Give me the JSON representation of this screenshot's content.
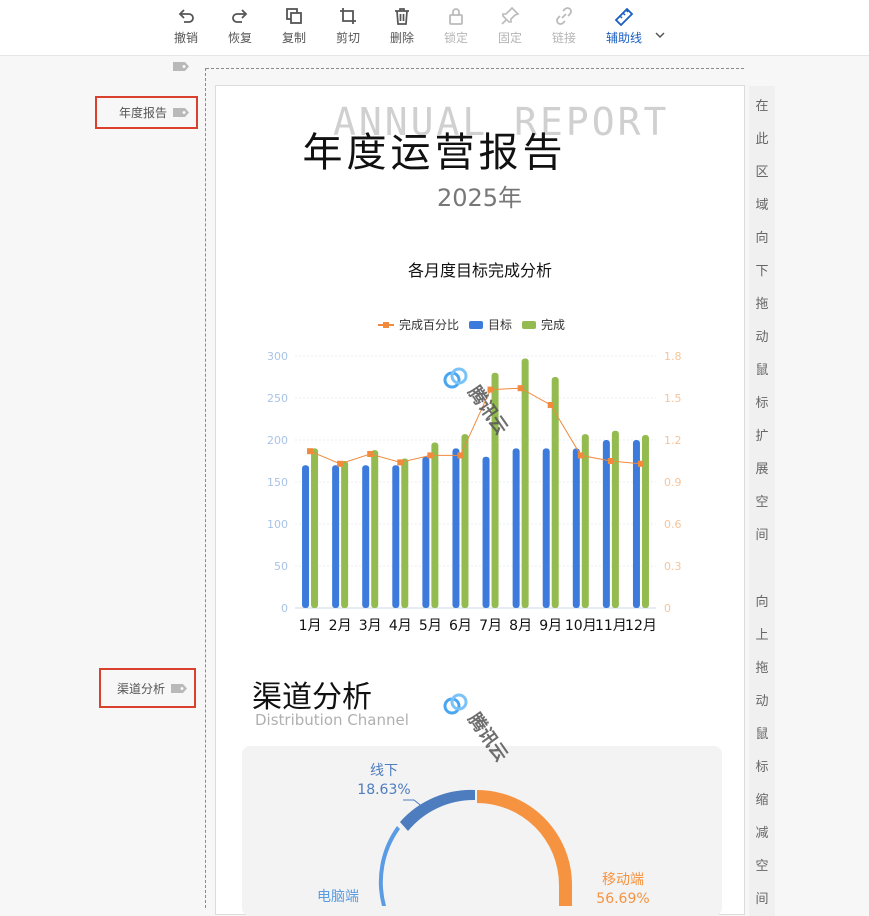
{
  "toolbar": {
    "items": [
      {
        "label": "撤销",
        "icon": "undo-icon",
        "state": "normal"
      },
      {
        "label": "恢复",
        "icon": "redo-icon",
        "state": "normal"
      },
      {
        "label": "复制",
        "icon": "copy-icon",
        "state": "normal"
      },
      {
        "label": "剪切",
        "icon": "crop-icon",
        "state": "normal"
      },
      {
        "label": "删除",
        "icon": "trash-icon",
        "state": "normal"
      },
      {
        "label": "锁定",
        "icon": "lock-icon",
        "state": "disabled"
      },
      {
        "label": "固定",
        "icon": "pin-icon",
        "state": "disabled"
      },
      {
        "label": "链接",
        "icon": "link-icon",
        "state": "disabled"
      },
      {
        "label": "辅助线",
        "icon": "ruler-icon",
        "state": "active"
      }
    ]
  },
  "sections": {
    "annual_tag": "年度报告",
    "channel_tag": "渠道分析"
  },
  "report": {
    "bg_text": "ANNUAL REPORT",
    "title": "年度运营报告",
    "year": "2025年"
  },
  "chart_data": {
    "type": "bar",
    "title": "各月度目标完成分析",
    "categories": [
      "1月",
      "2月",
      "3月",
      "4月",
      "5月",
      "6月",
      "7月",
      "8月",
      "9月",
      "10月",
      "11月",
      "12月"
    ],
    "series": [
      {
        "name": "目标",
        "kind": "bar",
        "axis": "left",
        "color": "#3c7bdc",
        "values": [
          170,
          170,
          170,
          170,
          180,
          190,
          180,
          190,
          190,
          190,
          200,
          200
        ]
      },
      {
        "name": "完成",
        "kind": "bar",
        "axis": "left",
        "color": "#93bb4f",
        "values": [
          190,
          175,
          188,
          178,
          197,
          207,
          280,
          297,
          275,
          207,
          211,
          206
        ]
      },
      {
        "name": "完成百分比",
        "kind": "line",
        "axis": "right",
        "color": "#f08a3c",
        "values": [
          1.12,
          1.03,
          1.1,
          1.04,
          1.09,
          1.09,
          1.56,
          1.57,
          1.45,
          1.09,
          1.05,
          1.03
        ]
      }
    ],
    "legend_order": [
      "完成百分比",
      "目标",
      "完成"
    ],
    "ylim": [
      0,
      300
    ],
    "yticks": [
      "0",
      "50",
      "100",
      "150",
      "200",
      "250",
      "300"
    ],
    "y2lim": [
      0,
      1.8
    ],
    "y2ticks": [
      "0",
      "0.3",
      "0.6",
      "0.9",
      "1.2",
      "1.5",
      "1.8"
    ],
    "legend_position": "top-center"
  },
  "channel": {
    "title": "渠道分析",
    "subtitle": "Distribution Channel",
    "labels": {
      "offline": {
        "name": "线下",
        "pct": "18.63%"
      },
      "pc": {
        "name": "电脑端"
      },
      "mobile": {
        "name": "移动端",
        "pct": "56.69%"
      }
    },
    "colors": {
      "offline": "#4d7dbf",
      "pc": "#5a9be3",
      "mobile": "#f59340"
    }
  },
  "watermark": "腾讯云",
  "rightbar": {
    "top_text": [
      "在",
      "此",
      "区",
      "域",
      "向",
      "下",
      "拖",
      "动",
      "鼠",
      "标",
      "扩",
      "展",
      "空",
      "间"
    ],
    "bottom_text": [
      "向",
      "上",
      "拖",
      "动",
      "鼠",
      "标",
      "缩",
      "减",
      "空",
      "间"
    ]
  }
}
